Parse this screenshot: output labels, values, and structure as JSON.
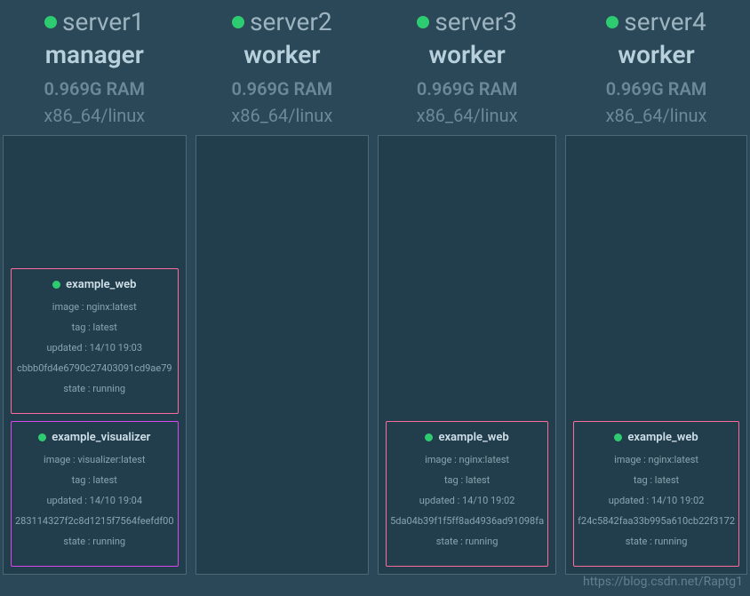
{
  "nodes": [
    {
      "name": "server1",
      "role": "manager",
      "ram": "0.969G RAM",
      "arch": "x86_64/linux",
      "tasks": [
        {
          "name": "example_web",
          "image": "image : nginx:latest",
          "tag": "tag : latest",
          "updated": "updated : 14/10 19:03",
          "id": "cbbb0fd4e6790c27403091cd9ae79",
          "state": "state : running",
          "variant": "pink"
        },
        {
          "name": "example_visualizer",
          "image": "image : visualizer:latest",
          "tag": "tag : latest",
          "updated": "updated : 14/10 19:04",
          "id": "283114327f2c8d1215f7564feefdf00",
          "state": "state : running",
          "variant": "magenta"
        }
      ]
    },
    {
      "name": "server2",
      "role": "worker",
      "ram": "0.969G RAM",
      "arch": "x86_64/linux",
      "tasks": []
    },
    {
      "name": "server3",
      "role": "worker",
      "ram": "0.969G RAM",
      "arch": "x86_64/linux",
      "tasks": [
        {
          "name": "example_web",
          "image": "image : nginx:latest",
          "tag": "tag : latest",
          "updated": "updated : 14/10 19:02",
          "id": "5da04b39f1f5ff8ad4936ad91098fa",
          "state": "state : running",
          "variant": "pink"
        }
      ]
    },
    {
      "name": "server4",
      "role": "worker",
      "ram": "0.969G RAM",
      "arch": "x86_64/linux",
      "tasks": [
        {
          "name": "example_web",
          "image": "image : nginx:latest",
          "tag": "tag : latest",
          "updated": "updated : 14/10 19:02",
          "id": "f24c5842faa33b995a610cb22f3172",
          "state": "state : running",
          "variant": "pink"
        }
      ]
    }
  ],
  "watermark": "https://blog.csdn.net/Raptg1"
}
